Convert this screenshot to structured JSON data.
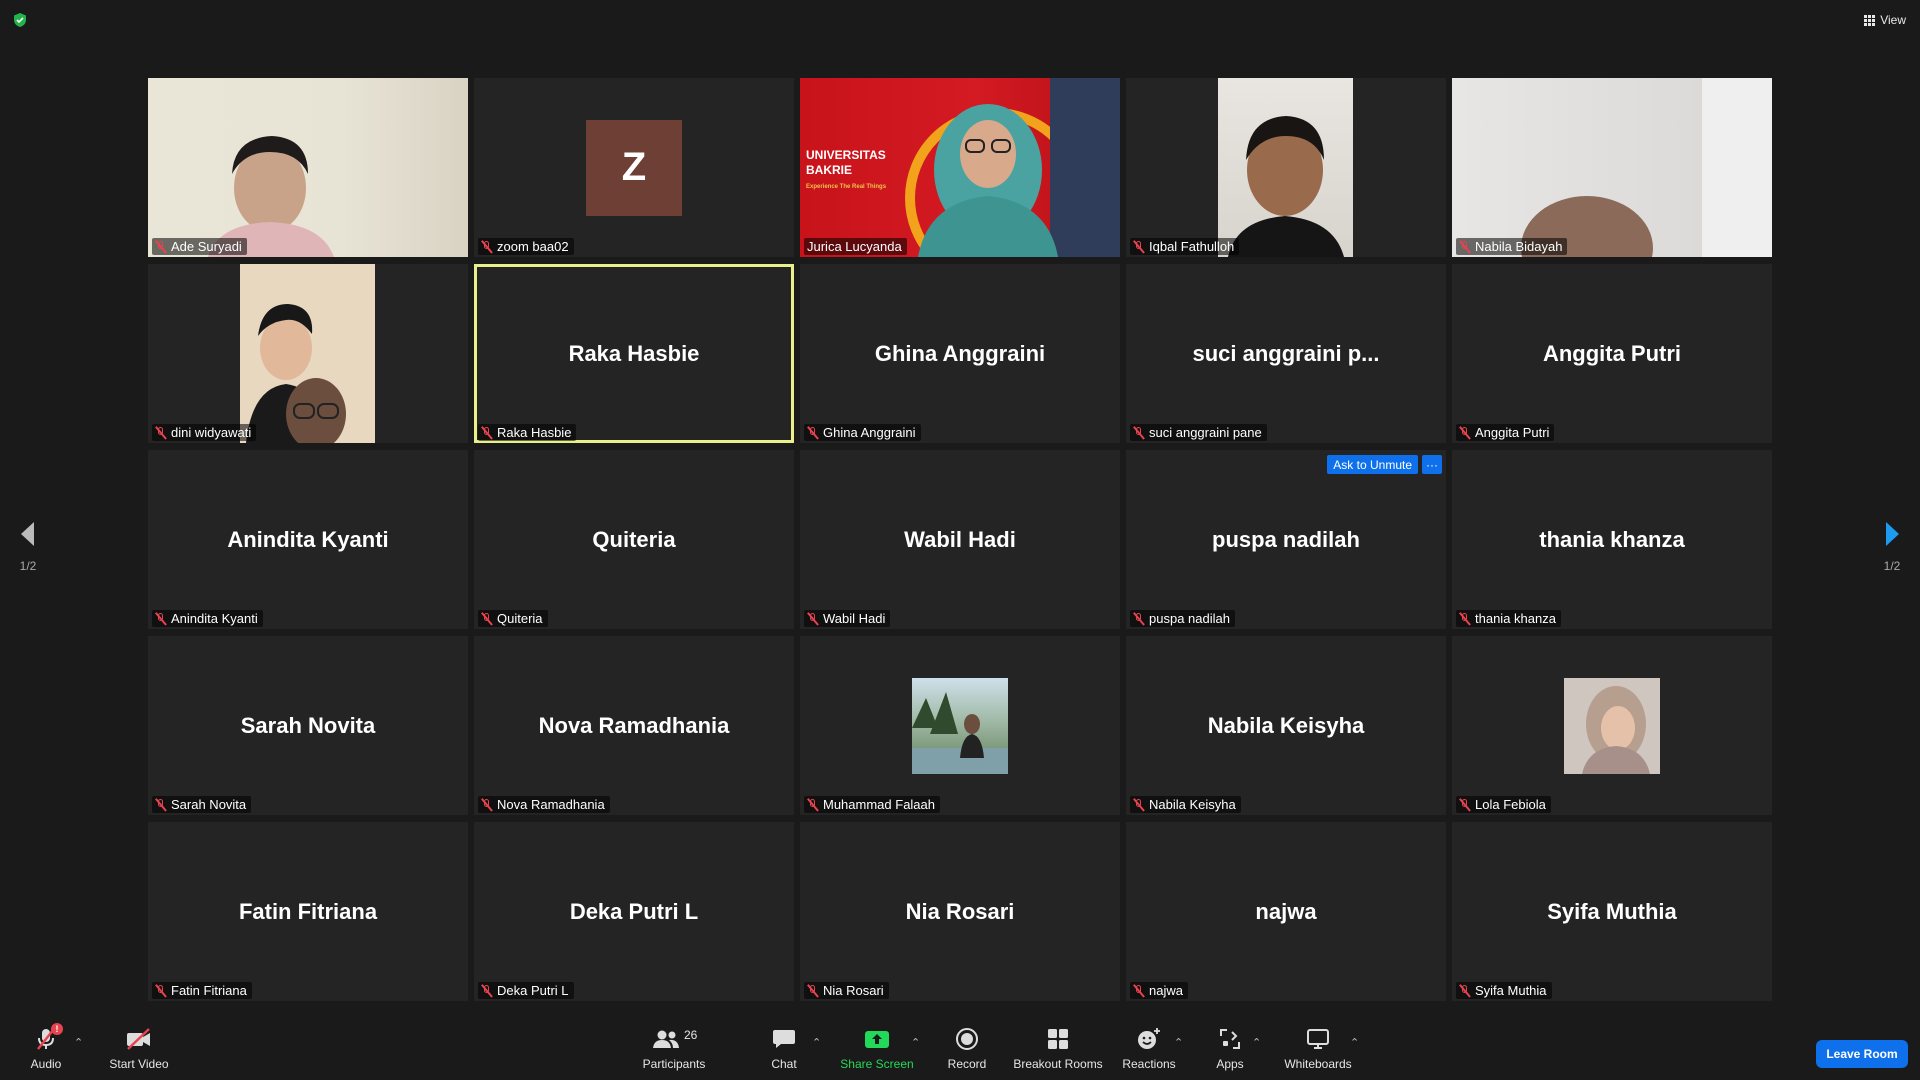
{
  "top": {
    "view_label": "View"
  },
  "pager": {
    "left_page": "1/2",
    "right_page": "1/2"
  },
  "tiles": [
    {
      "label": "Ade Suryadi",
      "big": ""
    },
    {
      "label": "zoom baa02",
      "big": "",
      "avatar": "Z"
    },
    {
      "label": "Jurica Lucyanda",
      "big": "",
      "banner": "UNIVERSITAS BAKRIE",
      "banner_sub": "Experience The Real Things"
    },
    {
      "label": "Iqbal Fathulloh",
      "big": ""
    },
    {
      "label": "Nabila Bidayah",
      "big": ""
    },
    {
      "label": "dini widyawati",
      "big": ""
    },
    {
      "label": "Raka Hasbie",
      "big": "Raka Hasbie"
    },
    {
      "label": "Ghina Anggraini",
      "big": "Ghina Anggraini"
    },
    {
      "label": "suci anggraini pane",
      "big": "suci anggraini p..."
    },
    {
      "label": "Anggita Putri",
      "big": "Anggita Putri"
    },
    {
      "label": "Anindita Kyanti",
      "big": "Anindita Kyanti"
    },
    {
      "label": "Quiteria",
      "big": "Quiteria"
    },
    {
      "label": "Wabil Hadi",
      "big": "Wabil Hadi"
    },
    {
      "label": "puspa nadilah",
      "big": "puspa nadilah",
      "ask_unmute": "Ask to Unmute",
      "more": "···"
    },
    {
      "label": "thania khanza",
      "big": "thania khanza"
    },
    {
      "label": "Sarah Novita",
      "big": "Sarah Novita"
    },
    {
      "label": "Nova Ramadhania",
      "big": "Nova Ramadhania"
    },
    {
      "label": "Muhammad Falaah",
      "big": ""
    },
    {
      "label": "Nabila Keisyha",
      "big": "Nabila Keisyha"
    },
    {
      "label": "Lola Febiola",
      "big": ""
    },
    {
      "label": "Fatin Fitriana",
      "big": "Fatin Fitriana"
    },
    {
      "label": "Deka Putri L",
      "big": "Deka Putri L"
    },
    {
      "label": "Nia Rosari",
      "big": "Nia Rosari"
    },
    {
      "label": "najwa",
      "big": "najwa"
    },
    {
      "label": "Syifa Muthia",
      "big": "Syifa Muthia"
    }
  ],
  "toolbar": {
    "audio": "Audio",
    "audio_badge": "!",
    "video": "Start Video",
    "participants": "Participants",
    "participants_count": "26",
    "chat": "Chat",
    "share": "Share Screen",
    "record": "Record",
    "breakout": "Breakout Rooms",
    "reactions": "Reactions",
    "apps": "Apps",
    "whiteboards": "Whiteboards",
    "leave": "Leave Room"
  },
  "colors": {
    "active_speaker": "#e9ef8a",
    "accent": "#0e71eb",
    "muted": "#e8434e",
    "share": "#23d959"
  }
}
